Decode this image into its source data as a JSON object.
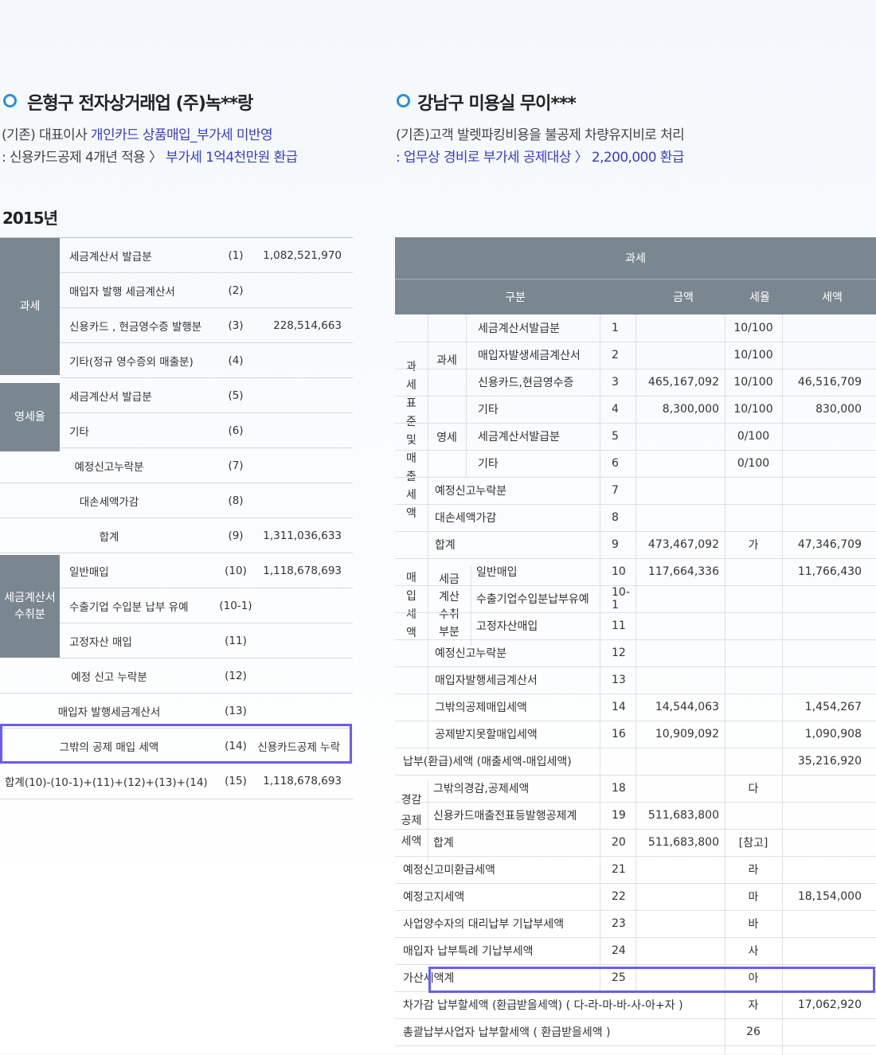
{
  "left": {
    "title": "은형구 전자상거래업 (주)녹**랑",
    "desc_line1_plain": "(기존) 대표이사 ",
    "desc_line1_hl": "개인카드 상품매입_부가세 미반영",
    "desc_line2_plain": ": 신용카드공제 4개년 적용 〉",
    "desc_line2_hl": " 부가세 1억4천만원 환급",
    "year": "2015년",
    "groups": {
      "g1": "과세",
      "g2": "영세율",
      "g3": "세금계산서\n수취분"
    },
    "rows": [
      {
        "label": "세금계산서 발급분",
        "num": "(1)",
        "value": "1,082,521,970"
      },
      {
        "label": "매입자 발행 세금계산서",
        "num": "(2)",
        "value": ""
      },
      {
        "label": "신용카드 , 현금영수증 발행분",
        "num": "(3)",
        "value": "228,514,663"
      },
      {
        "label": "기타(정규 영수증외 매출분)",
        "num": "(4)",
        "value": ""
      },
      {
        "label": "세금계산서 발급분",
        "num": "(5)",
        "value": ""
      },
      {
        "label": "기타",
        "num": "(6)",
        "value": ""
      },
      {
        "label": "예정신고누락분",
        "num": "(7)",
        "value": ""
      },
      {
        "label": "대손세액가감",
        "num": "(8)",
        "value": ""
      },
      {
        "label": "합계",
        "num": "(9)",
        "value": "1,311,036,633"
      },
      {
        "label": "일반매입",
        "num": "(10)",
        "value": "1,118,678,693"
      },
      {
        "label": "수출기업 수입분 납부 유예",
        "num": "(10-1)",
        "value": ""
      },
      {
        "label": "고정자산 매입",
        "num": "(11)",
        "value": ""
      },
      {
        "label": "예정 신고 누락분",
        "num": "(12)",
        "value": ""
      },
      {
        "label": "매입자 발행세금계산서",
        "num": "(13)",
        "value": ""
      },
      {
        "label": "그밖의 공제 매입 세액",
        "num": "(14)",
        "value": "신용카드공제 누락"
      },
      {
        "label": "합계(10)-(10-1)+(11)+(12)+(13)+(14)",
        "num": "(15)",
        "value": "1,118,678,693"
      }
    ]
  },
  "right": {
    "title": "강남구 미용실 무이***",
    "desc_line1": "(기존)고객 발렛파킹비용을 불공제 차량유지비로 처리",
    "desc_line2_hl": ": 업무상 경비로 부가세 공제대상 〉 2,200,000 환급",
    "header_top": "과세",
    "header_cols": {
      "gubun": "구분",
      "amount": "금액",
      "rate": "세율",
      "tax": "세액"
    },
    "vert_labels": {
      "sales": "과\n세\n표\n준\n및\n매\n출\n세\n액",
      "purchase": "매\n입\n세\n액",
      "invoice": "세금\n계산\n수취\n부분",
      "reduction": "경감\n공제\n세액",
      "taxable": "과세",
      "zero": "영세"
    },
    "rows": [
      {
        "label": "세금계산서발급분",
        "num": "1",
        "amount": "",
        "rate": "10/100",
        "tax": ""
      },
      {
        "label": "매입자발생세금계산서",
        "num": "2",
        "amount": "",
        "rate": "10/100",
        "tax": ""
      },
      {
        "label": "신용카드,현금영수증",
        "num": "3",
        "amount": "465,167,092",
        "rate": "10/100",
        "tax": "46,516,709"
      },
      {
        "label": "기타",
        "num": "4",
        "amount": "8,300,000",
        "rate": "10/100",
        "tax": "830,000"
      },
      {
        "label": "세금계산서발급분",
        "num": "5",
        "amount": "",
        "rate": "0/100",
        "tax": ""
      },
      {
        "label": "기타",
        "num": "6",
        "amount": "",
        "rate": "0/100",
        "tax": ""
      },
      {
        "label": "예정신고누락분",
        "num": "7",
        "amount": "",
        "rate": "",
        "tax": ""
      },
      {
        "label": "대손세액가감",
        "num": "8",
        "amount": "",
        "rate": "",
        "tax": ""
      },
      {
        "label": "합계",
        "num": "9",
        "amount": "473,467,092",
        "rate": "가",
        "tax": "47,346,709"
      },
      {
        "label": "일반매입",
        "num": "10",
        "amount": "117,664,336",
        "rate": "",
        "tax": "11,766,430"
      },
      {
        "label": "수출기업수입분납부유예",
        "num": "10-1",
        "amount": "",
        "rate": "",
        "tax": ""
      },
      {
        "label": "고정자산매입",
        "num": "11",
        "amount": "",
        "rate": "",
        "tax": ""
      },
      {
        "label": "예정신고누락분",
        "num": "12",
        "amount": "",
        "rate": "",
        "tax": ""
      },
      {
        "label": "매입자발행세금계산서",
        "num": "13",
        "amount": "",
        "rate": "",
        "tax": ""
      },
      {
        "label": "그밖의공제매입세액",
        "num": "14",
        "amount": "14,544,063",
        "rate": "",
        "tax": "1,454,267"
      },
      {
        "label": "공제받지못할매입세액",
        "num": "16",
        "amount": "10,909,092",
        "rate": "",
        "tax": "1,090,908"
      },
      {
        "label": "납부(환급)세액 (매출세액-매입세액)",
        "num": "",
        "amount": "",
        "rate": "",
        "tax": "35,216,920"
      },
      {
        "label": "그밖의경감,공제세액",
        "num": "18",
        "amount": "",
        "rate": "다",
        "tax": ""
      },
      {
        "label": "신용카드매출전표등발행공제계",
        "num": "19",
        "amount": "511,683,800",
        "rate": "",
        "tax": ""
      },
      {
        "label": "합계",
        "num": "20",
        "amount": "511,683,800",
        "rate": "[참고]",
        "tax": ""
      },
      {
        "label": "예정신고미환급세액",
        "num": "21",
        "amount": "",
        "rate": "라",
        "tax": ""
      },
      {
        "label": "예정고지세액",
        "num": "22",
        "amount": "",
        "rate": "마",
        "tax": "18,154,000"
      },
      {
        "label": "사업양수자의 대리납부 기납부세액",
        "num": "23",
        "amount": "",
        "rate": "바",
        "tax": ""
      },
      {
        "label": "매입자 납부특례 기납부세액",
        "num": "24",
        "amount": "",
        "rate": "사",
        "tax": ""
      },
      {
        "label": "가산세액계",
        "num": "25",
        "amount": "",
        "rate": "아",
        "tax": ""
      },
      {
        "label": "차가감 납부할세액 (환급받을세액) ( 다-라-마-바-사-아+자 )",
        "num": "",
        "amount": "",
        "rate": "자",
        "tax": "17,062,920"
      },
      {
        "label": "총괄납부사업자 납부할세액 ( 환급받을세액 )",
        "num": "",
        "amount": "",
        "rate": "26",
        "tax": ""
      }
    ]
  }
}
